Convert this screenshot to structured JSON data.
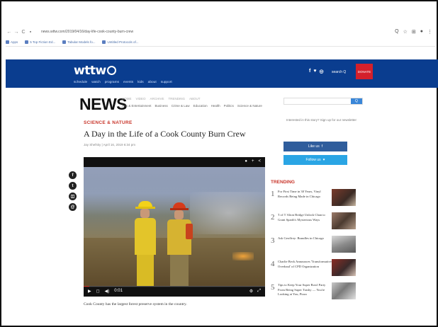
{
  "browser": {
    "url": "news.wttw.com/2019/04/16/day-life-cook-county-burn-crew",
    "bookmarks": [
      "Apps",
      "5 Top Fiction Ed...",
      "Tabular Models fo...",
      "Untitled Protocols of..."
    ]
  },
  "site": {
    "logo_text": "wttw",
    "nav": [
      "schedule",
      "watch",
      "programs",
      "events",
      "kids",
      "about",
      "support"
    ],
    "search_label": "search",
    "donate_label": "DONATE"
  },
  "news": {
    "heading": "NEWS",
    "subnav1": [
      "HOME",
      "VIDEO",
      "ARCHIVE",
      "TRENDING",
      "ABOUT"
    ],
    "subnav2": [
      "Arts & Entertainment",
      "Business",
      "Crime & Law",
      "Education",
      "Health",
      "Politics",
      "Science & Nature"
    ],
    "search_button": "Q"
  },
  "article": {
    "section": "SCIENCE & NATURE",
    "title": "A Day in the Life of a Cook County Burn Crew",
    "byline": "Jay Shefsky | April 16, 2019 6:34 pm",
    "caption": "Cook County has the largest forest preserve system in the country."
  },
  "sidebar": {
    "link": "Interested in this story? Sign up for our newsletter",
    "facebook_label": "Like us",
    "twitter_label": "Follow us"
  },
  "share_icons": [
    "facebook-icon",
    "twitter-icon",
    "flipboard-icon",
    "email-icon"
  ],
  "video": {
    "progress": 0.03,
    "top_icons": [
      "info",
      "share",
      "expand"
    ],
    "controls_left": [
      "play",
      "cc",
      "volume",
      "time"
    ],
    "time": "0:01",
    "controls_right": [
      "settings",
      "fullscreen"
    ]
  },
  "trending": {
    "heading": "TRENDING",
    "items": [
      {
        "num": "1",
        "text": "For First Time in 30 Years, Vinyl Records Being Made in Chicago"
      },
      {
        "num": "2",
        "text": "'I of 5' Alton Bridge Unlock Chan to Grant Sparth's Mysterious Ways"
      },
      {
        "num": "3",
        "text": "Ask Geoffrey: Brandles in Chicago"
      },
      {
        "num": "4",
        "text": "Charlie Beck Announces 'Transformative Overhaul' of CPD Organization"
      },
      {
        "num": "5",
        "text": "Tips to Keep Your Super Bowl Party From Being Super Trashy — You're Looking at You, Pizza"
      }
    ]
  }
}
